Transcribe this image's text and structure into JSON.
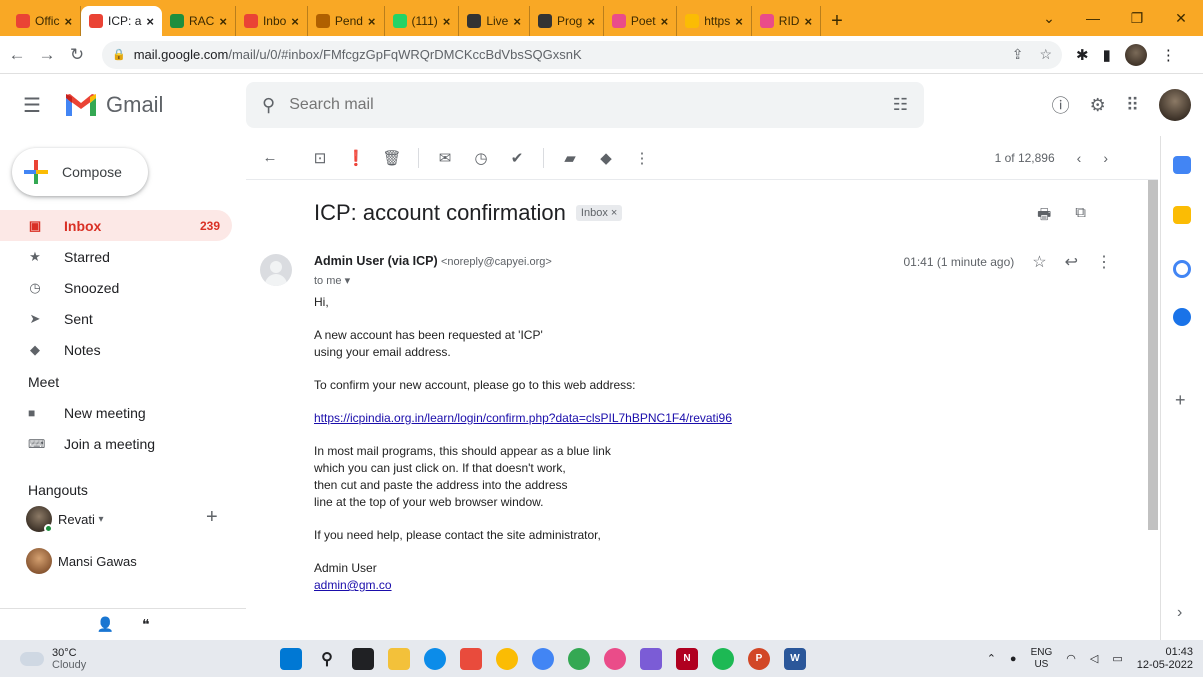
{
  "browser": {
    "tabs": [
      {
        "label": "Offic",
        "favicon": "gmail-icon",
        "color": "#ea4335",
        "active": false
      },
      {
        "label": "ICP: a",
        "favicon": "gmail-icon",
        "color": "#ea4335",
        "active": true
      },
      {
        "label": "RAC",
        "favicon": "drive-icon",
        "color": "#1e8e3e",
        "active": false
      },
      {
        "label": "Inbo",
        "favicon": "gmail-icon",
        "color": "#ea4335",
        "active": false
      },
      {
        "label": "Pend",
        "favicon": "page-icon",
        "color": "#b06000",
        "active": false
      },
      {
        "label": "(111)",
        "favicon": "whatsapp-icon",
        "color": "#25d366",
        "active": false
      },
      {
        "label": "Live",
        "favicon": "wix-icon",
        "color": "#333333",
        "active": false
      },
      {
        "label": "Prog",
        "favicon": "wix-icon",
        "color": "#333333",
        "active": false
      },
      {
        "label": "Poet",
        "favicon": "dribbble-icon",
        "color": "#ea4c89",
        "active": false
      },
      {
        "label": "https",
        "favicon": "globe-icon",
        "color": "#fbbc04",
        "active": false
      },
      {
        "label": "RID",
        "favicon": "dribbble-icon",
        "color": "#ea4c89",
        "active": false
      }
    ],
    "url_host": "mail.google.com",
    "url_path": "/mail/u/0/#inbox/FMfcgzGpFqWRQrDMCKccBdVbsSQGxsnK"
  },
  "gmail": {
    "wordmark": "Gmail",
    "search_placeholder": "Search mail",
    "compose_label": "Compose",
    "nav": [
      {
        "label": "Inbox",
        "icon": "inbox-icon",
        "glyph": "▣",
        "count": "239",
        "active": true
      },
      {
        "label": "Starred",
        "icon": "star-icon",
        "glyph": "★",
        "count": "",
        "active": false
      },
      {
        "label": "Snoozed",
        "icon": "clock-icon",
        "glyph": "◷",
        "count": "",
        "active": false
      },
      {
        "label": "Sent",
        "icon": "send-icon",
        "glyph": "➤",
        "count": "",
        "active": false
      },
      {
        "label": "Notes",
        "icon": "label-icon",
        "glyph": "◆",
        "count": "",
        "active": false
      }
    ],
    "meet": {
      "heading": "Meet",
      "new_meeting": "New meeting",
      "join_meeting": "Join a meeting"
    },
    "hangouts": {
      "heading": "Hangouts",
      "self_name": "Revati",
      "self_dropdown": "▾",
      "add": "+",
      "contact": "Mansi Gawas"
    },
    "pager": {
      "text": "1 of 12,896",
      "prev": "‹",
      "next": "›"
    },
    "email": {
      "subject": "ICP: account confirmation",
      "label_chip": "Inbox ×",
      "sender_name": "Admin User (via ICP)",
      "sender_address": "<noreply@capyei.org>",
      "recipient": "to me ▾",
      "time": "01:41 (1 minute ago)",
      "greeting": "Hi,",
      "para1_line1": "A new account has been requested at 'ICP'",
      "para1_line2": "using your email address.",
      "para2": "To confirm your new account, please go to this web address:",
      "link": "https://icpindia.org.in/learn/login/confirm.php?data=clsPIL7hBPNC1F4/revati96",
      "para3_line1": "In most mail programs, this should appear as a blue link",
      "para3_line2": "which you can just click on. If that doesn't work,",
      "para3_line3": "then cut and paste the address into the address",
      "para3_line4": "line at the top of your web browser window.",
      "para4": "If you need help, please contact the site administrator,",
      "signature_name": "Admin User",
      "signature_email": "admin@gm.co"
    }
  },
  "taskbar": {
    "temperature": "30°C",
    "condition": "Cloudy",
    "language": "ENG",
    "region": "US",
    "time": "01:43",
    "date": "12-05-2022"
  },
  "colors": {
    "tabstrip": "#f9a825",
    "accent_red": "#d93025",
    "inbox_active_bg": "#fce8e6",
    "link": "#1a0dab"
  }
}
